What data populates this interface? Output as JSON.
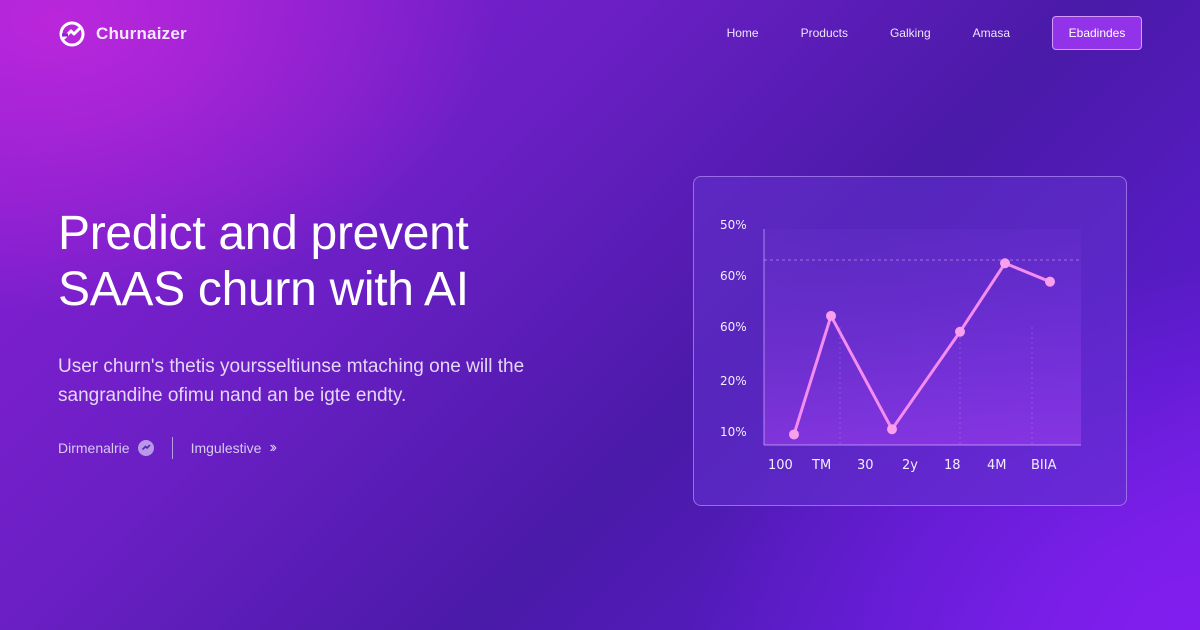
{
  "brand": {
    "name": "Churnaizer",
    "logo_icon": "churnaizer-logo-icon"
  },
  "nav": {
    "links": [
      "Home",
      "Products",
      "Galking",
      "Amasa"
    ],
    "cta_label": "Ebadindes"
  },
  "hero": {
    "title_lines": [
      "Predict and prevent",
      "SAAS churn with AI"
    ],
    "description_lines": [
      "User churn's thetis yoursseltiunse mtaching one will the",
      "sangrandihe ofimu nand an be igte endty."
    ],
    "primary_action": {
      "label": "Dirmenalrie",
      "icon": "circle-logo-icon"
    },
    "secondary_action": {
      "label": "Imgulestive",
      "icon": "double-chevron-right-icon"
    }
  },
  "chart_data": {
    "type": "line",
    "title": "",
    "xlabel": "",
    "ylabel": "",
    "y_tick_labels": [
      "50%",
      "60%",
      "60%",
      "20%",
      "10%"
    ],
    "x_tick_labels": [
      "100",
      "TM",
      "30",
      "2y",
      "18",
      "4M",
      "BIIA"
    ],
    "series": [
      {
        "values": [
          12,
          57,
          14,
          51,
          77,
          70
        ]
      }
    ],
    "ylim": [
      8,
      90
    ],
    "grid": true,
    "legend": "none",
    "colors": {
      "line": "#f58cf0",
      "marker": "#f8a0ee"
    }
  },
  "colors": {
    "accent": "#9233ea",
    "accent_border": "#d59bff",
    "background_start": "#8a1fd6",
    "background_end": "#4a1aa8"
  }
}
